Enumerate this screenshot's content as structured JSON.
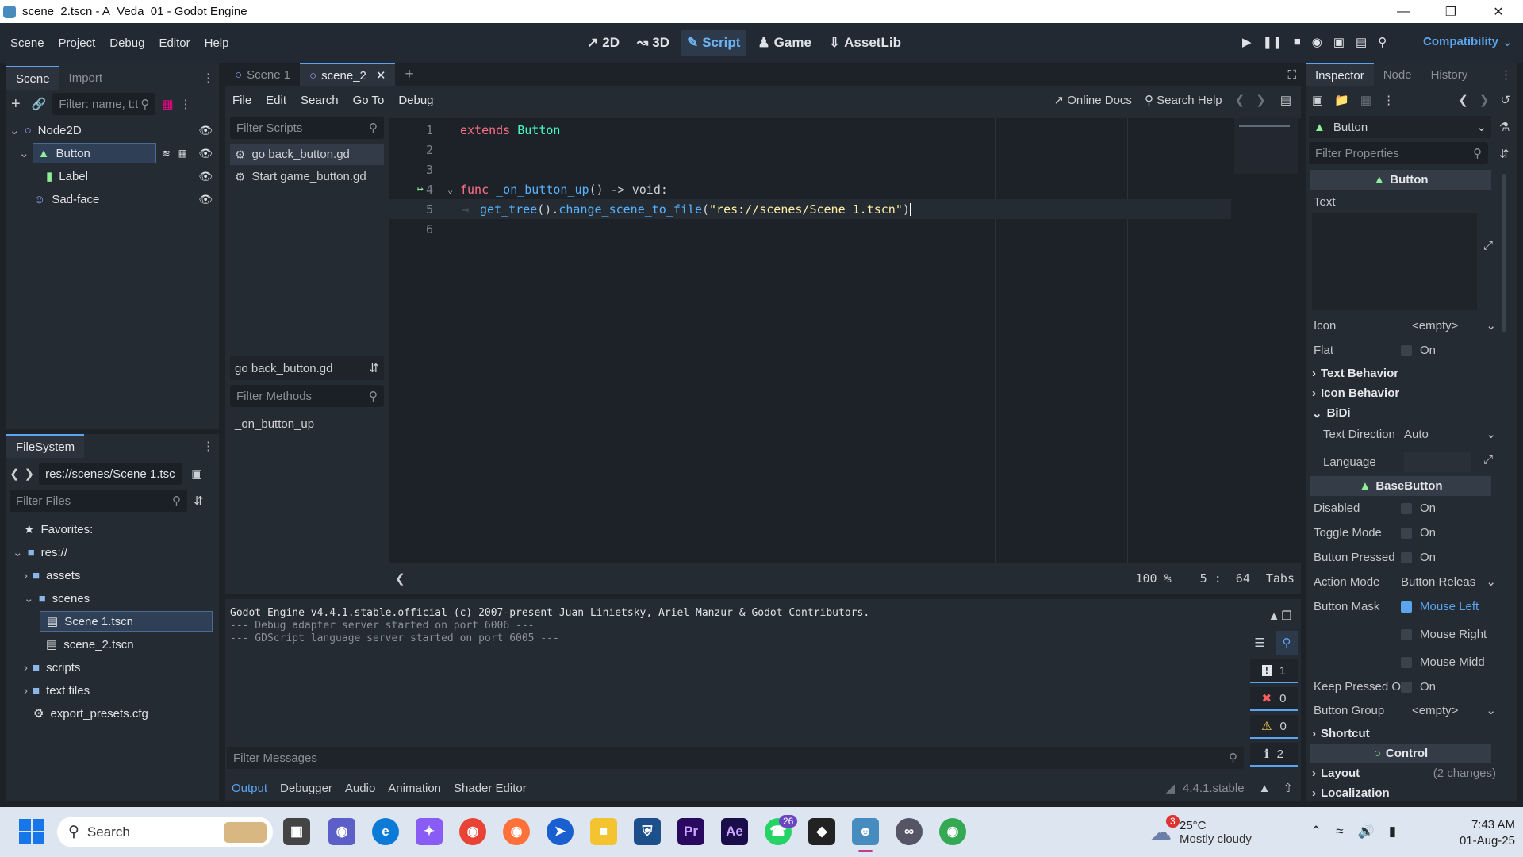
{
  "window": {
    "title": "scene_2.tscn - A_Veda_01 - Godot Engine"
  },
  "menu": [
    "Scene",
    "Project",
    "Debug",
    "Editor",
    "Help"
  ],
  "workspaces": [
    {
      "label": "2D",
      "icon": "2d-icon"
    },
    {
      "label": "3D",
      "icon": "3d-icon"
    },
    {
      "label": "Script",
      "icon": "script-icon"
    },
    {
      "label": "Game",
      "icon": "game-icon"
    },
    {
      "label": "AssetLib",
      "icon": "assetlib-icon"
    }
  ],
  "renderer": "Compatibility",
  "scene_dock": {
    "tabs": [
      "Scene",
      "Import"
    ],
    "filter_placeholder": "Filter: name, t:t",
    "nodes": [
      {
        "name": "Node2D",
        "icon": "node2d-icon"
      },
      {
        "name": "Button",
        "icon": "button-icon",
        "selected": true
      },
      {
        "name": "Label",
        "icon": "label-icon"
      },
      {
        "name": "Sad-face",
        "icon": "sprite-icon"
      }
    ]
  },
  "filesystem": {
    "title": "FileSystem",
    "path": "res://scenes/Scene 1.tscn",
    "filter_placeholder": "Filter Files",
    "items": [
      {
        "name": "Favorites:",
        "icon": "star-icon"
      },
      {
        "name": "res://",
        "icon": "folder-icon"
      },
      {
        "name": "assets",
        "icon": "folder-icon"
      },
      {
        "name": "scenes",
        "icon": "folder-icon"
      },
      {
        "name": "Scene 1.tscn",
        "icon": "scene-icon",
        "selected": true
      },
      {
        "name": "scene_2.tscn",
        "icon": "scene-icon"
      },
      {
        "name": "scripts",
        "icon": "folder-icon"
      },
      {
        "name": "text files",
        "icon": "folder-icon"
      },
      {
        "name": "export_presets.cfg",
        "icon": "gear-icon"
      }
    ]
  },
  "scene_tabs": [
    "Scene 1",
    "scene_2"
  ],
  "script_menu": [
    "File",
    "Edit",
    "Search",
    "Go To",
    "Debug"
  ],
  "script_links": {
    "online_docs": "Online Docs",
    "search_help": "Search Help"
  },
  "scripts_panel": {
    "filter_placeholder": "Filter Scripts",
    "scripts": [
      "go back_button.gd",
      "Start game_button.gd"
    ],
    "current": "go back_button.gd",
    "methods_placeholder": "Filter Methods",
    "methods": [
      "_on_button_up"
    ]
  },
  "code": {
    "line_numbers": [
      "1",
      "2",
      "3",
      "4",
      "5",
      "6"
    ],
    "line1": {
      "kw": "extends",
      "type": "Button"
    },
    "line4": {
      "kw": "func",
      "name": "_on_button_up",
      "rest": "() -> void:"
    },
    "line5": {
      "a": "get_tree",
      "b": "().",
      "c": "change_scene_to_file",
      "d": "(",
      "str": "\"res://scenes/Scene 1.tscn\"",
      "e": ")"
    }
  },
  "status": {
    "zoom": "100 %",
    "pos": "5 :  64",
    "indent": "Tabs"
  },
  "output": {
    "lines": [
      "Godot Engine v4.4.1.stable.official (c) 2007-present Juan Linietsky, Ariel Manzur & Godot Contributors.",
      "--- Debug adapter server started on port 6006 ---",
      "--- GDScript language server started on port 6005 ---"
    ],
    "filter_placeholder": "Filter Messages",
    "counts": {
      "messages": "1",
      "errors": "0",
      "warnings": "0",
      "info": "2"
    }
  },
  "bottom_tabs": [
    "Output",
    "Debugger",
    "Audio",
    "Animation",
    "Shader Editor"
  ],
  "version": "4.4.1.stable",
  "inspector": {
    "tabs": [
      "Inspector",
      "Node",
      "History"
    ],
    "object": "Button",
    "filter_placeholder": "Filter Properties",
    "class_button": "Button",
    "text_label": "Text",
    "icon": {
      "label": "Icon",
      "value": "<empty>"
    },
    "flat": {
      "label": "Flat",
      "value": "On"
    },
    "sections1": [
      "Text Behavior",
      "Icon Behavior",
      "BiDi"
    ],
    "text_direction": {
      "label": "Text Direction",
      "value": "Auto"
    },
    "language": {
      "label": "Language"
    },
    "class_basebutton": "BaseButton",
    "disabled": {
      "label": "Disabled",
      "value": "On"
    },
    "toggle": {
      "label": "Toggle Mode",
      "value": "On"
    },
    "pressed": {
      "label": "Button Pressed",
      "value": "On"
    },
    "action_mode": {
      "label": "Action Mode",
      "value": "Button Releas"
    },
    "mask": {
      "label": "Button Mask",
      "options": [
        "Mouse Left",
        "Mouse Right",
        "Mouse Midd"
      ]
    },
    "keep": {
      "label": "Keep Pressed O",
      "value": "On"
    },
    "group": {
      "label": "Button Group",
      "value": "<empty>"
    },
    "shortcut": "Shortcut",
    "class_control": "Control",
    "layout": {
      "label": "Layout",
      "note": "(2 changes)"
    },
    "localization": "Localization"
  },
  "taskbar": {
    "search": "Search",
    "weather_temp": "25°C",
    "weather_desc": "Mostly cloudy",
    "weather_badge": "3",
    "whatsapp_badge": "26",
    "time": "7:43 AM",
    "date": "01-Aug-25"
  }
}
